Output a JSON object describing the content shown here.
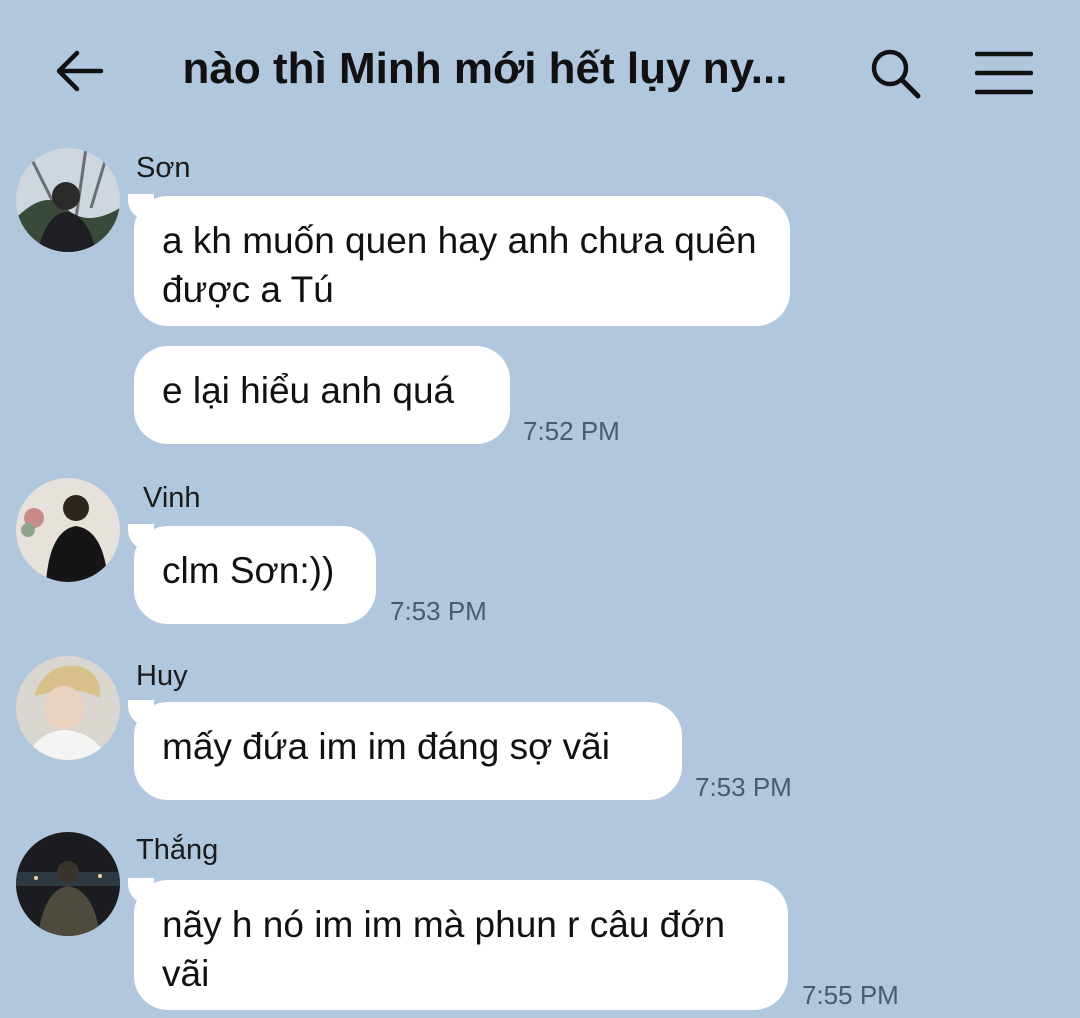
{
  "header": {
    "title": "nào thì Minh mới hết lụy ny...",
    "back_icon": "arrow-left-icon",
    "search_icon": "search-icon",
    "menu_icon": "hamburger-menu-icon"
  },
  "messages": [
    {
      "sender": "Sơn",
      "avatar": "avatar-son",
      "bubbles": [
        "a kh muốn quen hay anh chưa quên được a Tú",
        "e lại hiểu anh quá"
      ],
      "time": "7:52 PM"
    },
    {
      "sender": "Vinh",
      "avatar": "avatar-vinh",
      "bubbles": [
        "clm Sơn:))"
      ],
      "time": "7:53 PM"
    },
    {
      "sender": "Huy",
      "avatar": "avatar-huy",
      "bubbles": [
        "mấy đứa im im đáng sợ vãi"
      ],
      "time": "7:53 PM"
    },
    {
      "sender": "Thắng",
      "avatar": "avatar-thang",
      "bubbles": [
        "nãy h nó im im mà phun r câu đớn vãi"
      ],
      "time": "7:55 PM"
    }
  ],
  "colors": {
    "background": "#b1c7dd",
    "bubble": "#ffffff",
    "time_text": "#4b5b6b"
  }
}
